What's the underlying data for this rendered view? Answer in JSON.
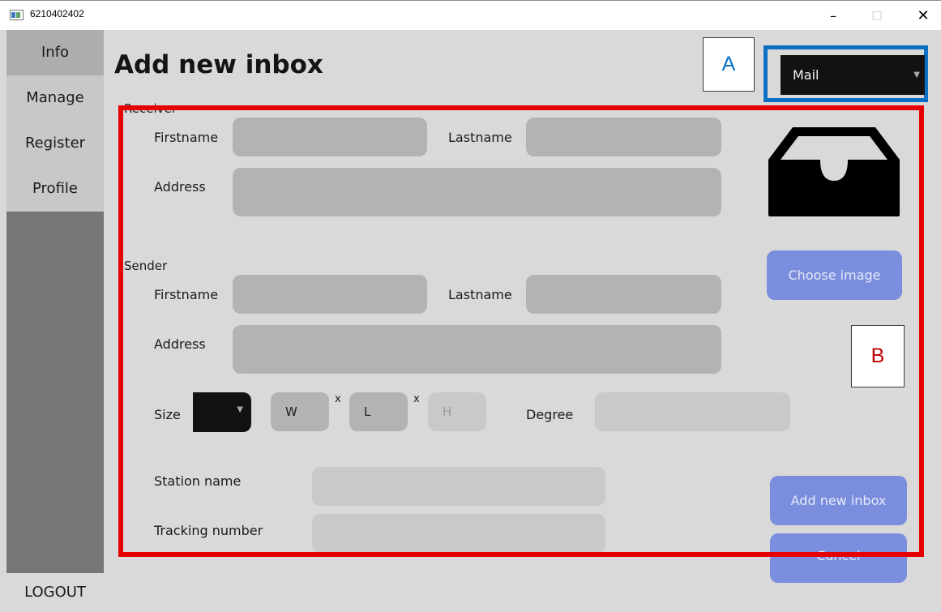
{
  "window": {
    "title": "6210402402",
    "minimize": "–",
    "maximize": "□",
    "close": "✕"
  },
  "sidebar": {
    "items": [
      {
        "label": "Info"
      },
      {
        "label": "Manage"
      },
      {
        "label": "Register"
      },
      {
        "label": "Profile"
      }
    ],
    "logout": "LOGOUT"
  },
  "page": {
    "title": "Add new inbox"
  },
  "annotations": {
    "a": "A",
    "b": "B",
    "a_color": "#0b6fc4",
    "b_color": "#e60000"
  },
  "mode_select": {
    "value": "Mail"
  },
  "receiver": {
    "section": "Receiver",
    "firstname_label": "Firstname",
    "lastname_label": "Lastname",
    "address_label": "Address"
  },
  "sender": {
    "section": "Sender",
    "firstname_label": "Firstname",
    "lastname_label": "Lastname",
    "address_label": "Address"
  },
  "size": {
    "label": "Size",
    "width_placeholder": "W",
    "length_placeholder": "L",
    "height_placeholder": "H",
    "separator": "x",
    "degree_label": "Degree"
  },
  "station": {
    "label": "Station name"
  },
  "tracking": {
    "label": "Tracking number"
  },
  "buttons": {
    "choose_image": "Choose image",
    "add_inbox": "Add new inbox",
    "cancel": "Cancel",
    "accent": "#7b8edd"
  },
  "icons": {
    "inbox": "inbox-tray-icon",
    "app": "app-window-icon"
  }
}
